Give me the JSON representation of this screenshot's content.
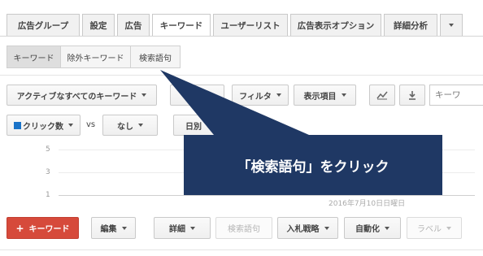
{
  "tabs": [
    {
      "label": "広告グループ",
      "active": false
    },
    {
      "label": "設定",
      "active": false
    },
    {
      "label": "広告",
      "active": false
    },
    {
      "label": "キーワード",
      "active": true
    },
    {
      "label": "ユーザーリスト",
      "active": false
    },
    {
      "label": "広告表示オプション",
      "active": false
    },
    {
      "label": "詳細分析",
      "active": false
    }
  ],
  "subtabs": [
    {
      "label": "キーワード",
      "active": true
    },
    {
      "label": "除外キーワード",
      "active": false
    },
    {
      "label": "検索語句",
      "active": false
    }
  ],
  "toolbar": {
    "keyword_filter": "アクティブなすべてのキーワード",
    "filter": "フィルタ",
    "columns": "表示項目",
    "search_placeholder": "キーワ"
  },
  "chart_controls": {
    "metric1": "クリック数",
    "vs": "vs",
    "metric2": "なし",
    "period": "日別"
  },
  "chart": {
    "yticks": [
      "5",
      "3",
      "1"
    ],
    "date_label": "2016年7月10日日曜日"
  },
  "callout": {
    "text": "「検索語句」をクリック"
  },
  "bottom_toolbar": {
    "add_keyword": "キーワード",
    "edit": "編集",
    "details": "詳細",
    "search_terms": "検索語句",
    "bid_strategy": "入札戦略",
    "automate": "自動化",
    "labels": "ラベル"
  },
  "colors": {
    "callout": "#1f3864",
    "primary": "#d64a3b",
    "metric_square": "#1a73c8"
  }
}
